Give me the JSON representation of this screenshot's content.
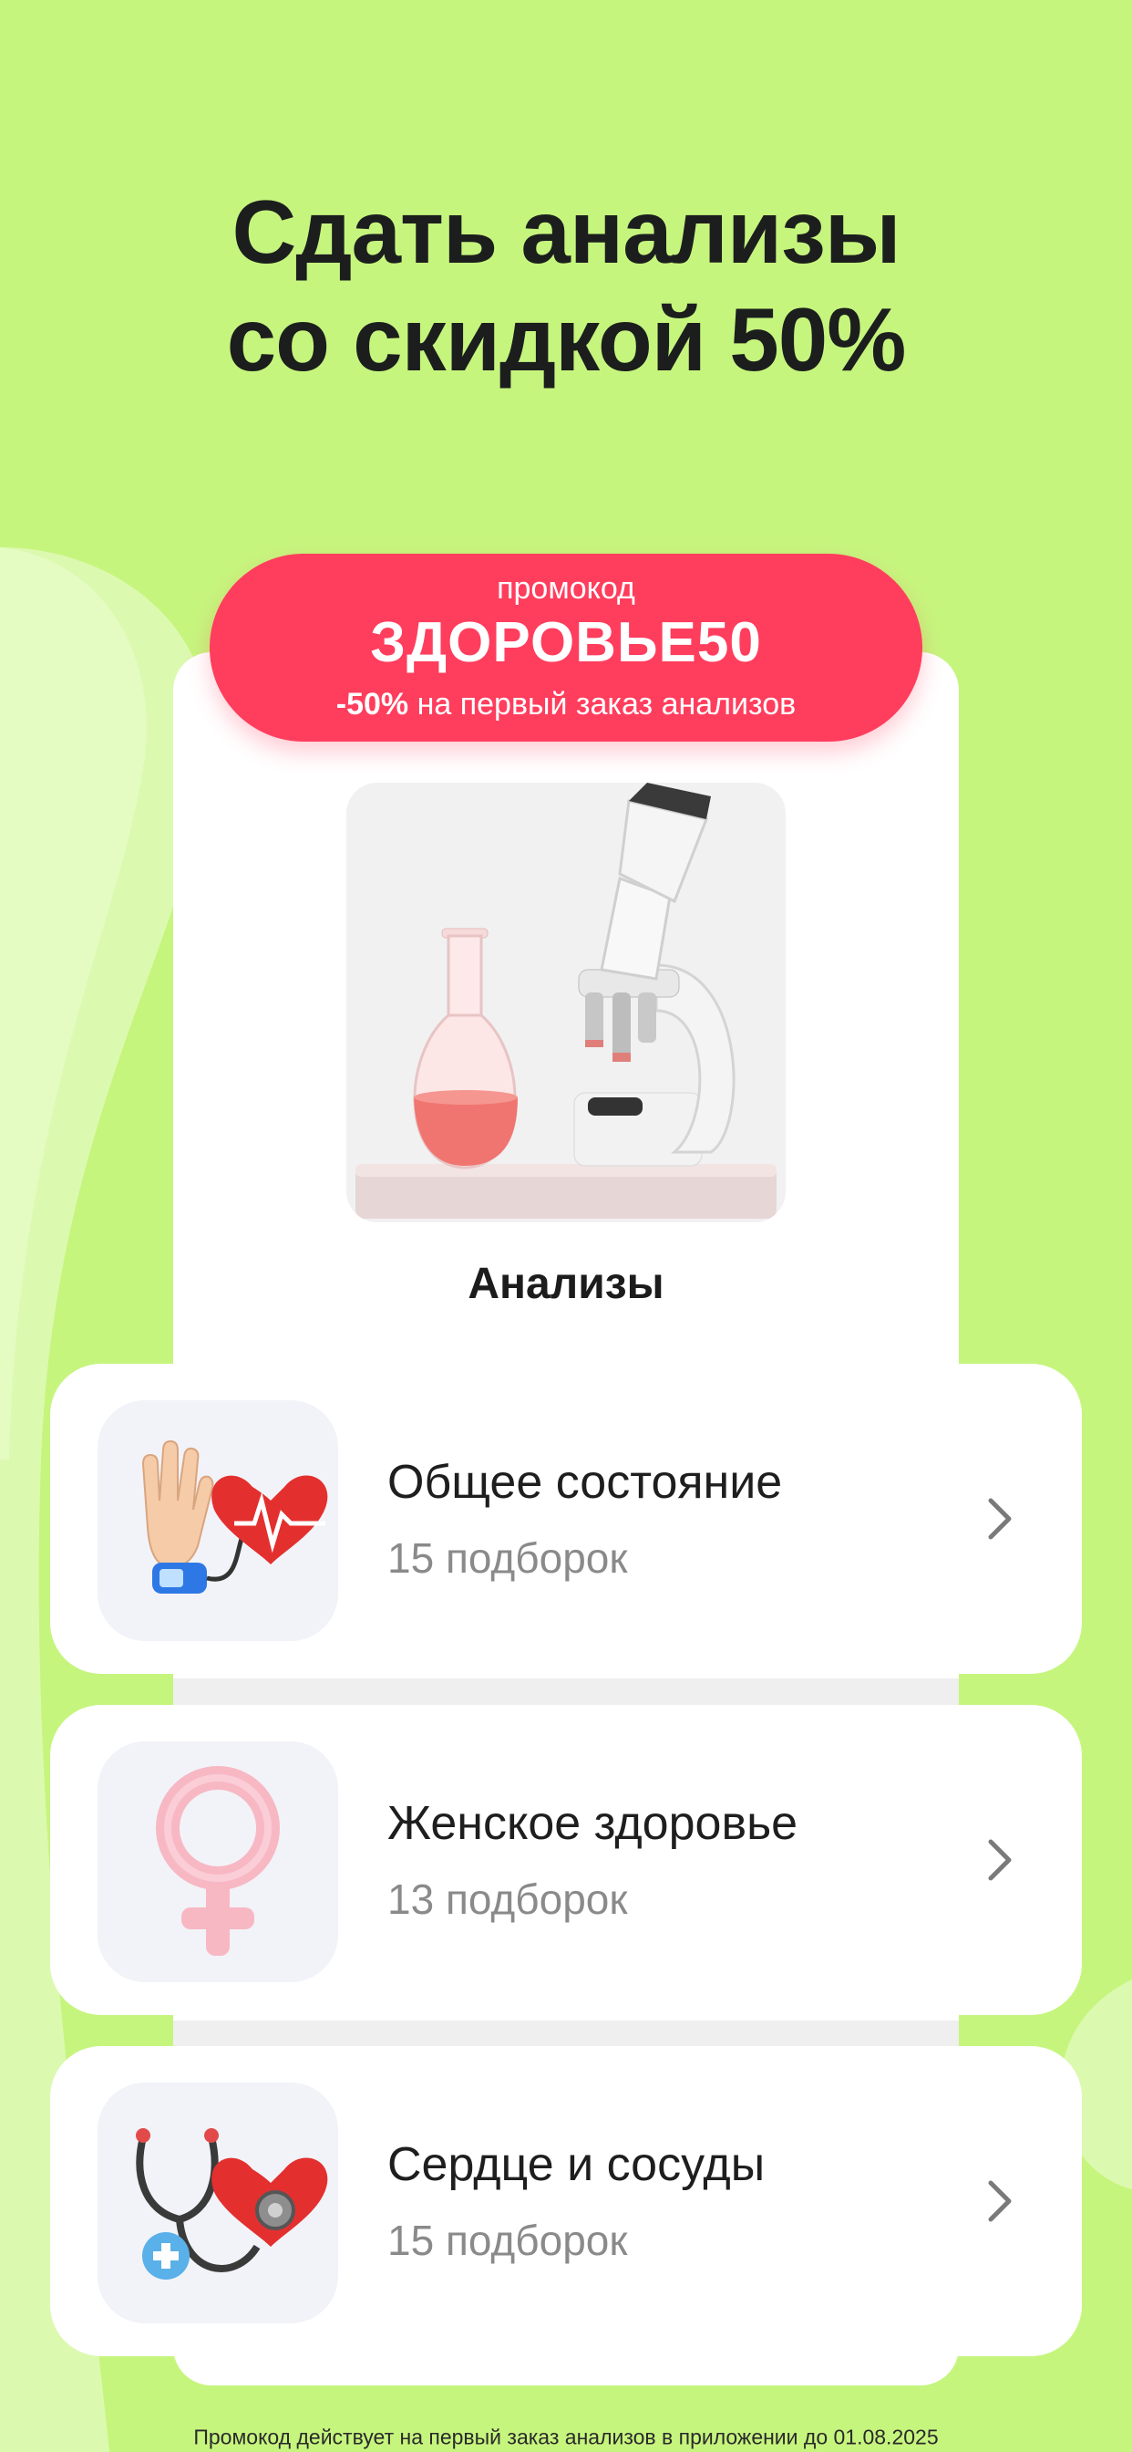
{
  "headline": {
    "line1": "Сдать анализы",
    "line2": "со скидкой 50%"
  },
  "promo": {
    "label": "промокод",
    "code": "ЗДОРОВЬЕ50",
    "discount": "-50%",
    "description": " на первый заказ анализов"
  },
  "hero": {
    "title": "Анализы",
    "image": "microscope-and-flask-illustration"
  },
  "categories": [
    {
      "title": "Общее состояние",
      "subtitle": "15 подборок",
      "icon": "hand-heart-pulse-icon"
    },
    {
      "title": "Женское здоровье",
      "subtitle": "13 подборок",
      "icon": "female-symbol-icon"
    },
    {
      "title": "Сердце и сосуды",
      "subtitle": "15 подборок",
      "icon": "stethoscope-heart-icon"
    }
  ],
  "footnote": "Промокод действует на первый заказ анализов в приложении до 01.08.2025",
  "colors": {
    "background": "#c6f57e",
    "promo": "#ff3d5d",
    "card": "#ffffff",
    "thumb": "#f2f3f8"
  }
}
